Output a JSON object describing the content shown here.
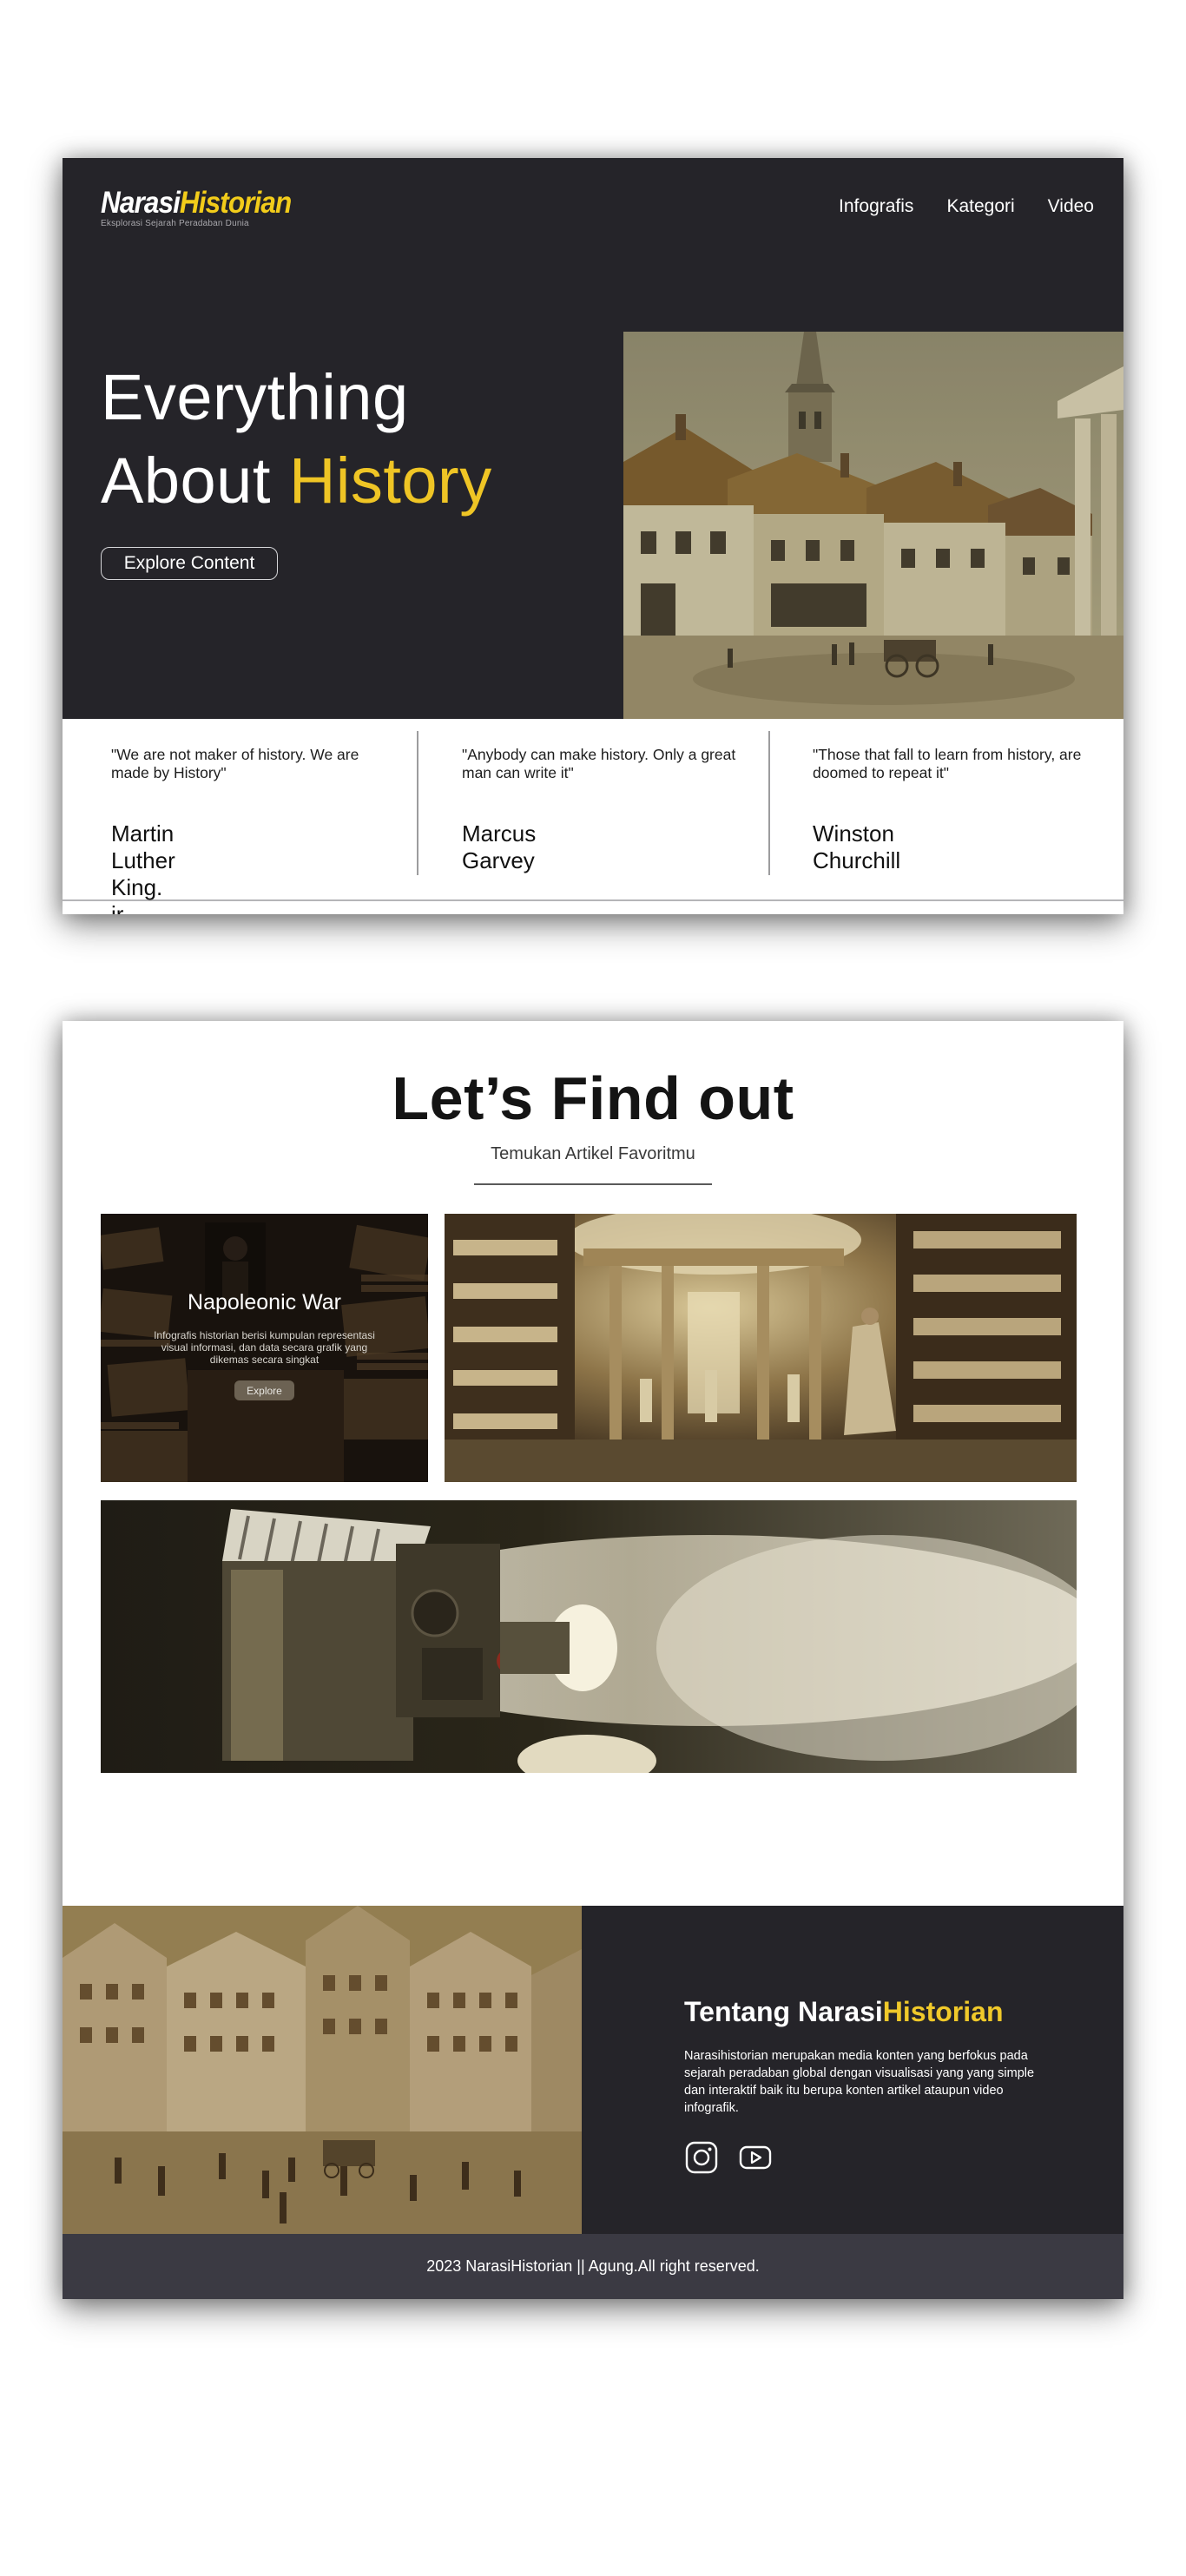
{
  "header": {
    "logo_part1": "Narasi",
    "logo_part2": "Historian",
    "tagline": "Eksplorasi Sejarah Peradaban Dunia",
    "nav": [
      "Infografis",
      "Kategori",
      "Video"
    ]
  },
  "hero": {
    "title_line1": "Everything",
    "title_line2_prefix": "About ",
    "title_line2_highlight": "History",
    "button_label": "Explore Content"
  },
  "quotes": [
    {
      "text": "\"We are not maker of history. We are made by History\"",
      "author": "Martin Luther King. jr"
    },
    {
      "text": "\"Anybody can make history. Only a great man can write it\"",
      "author": "Marcus Garvey"
    },
    {
      "text": "\"Those that fall to learn from history, are doomed to repeat it\"",
      "author": "Winston Churchill"
    }
  ],
  "find": {
    "title": "Let’s Find out",
    "subtitle": "Temukan Artikel Favoritmu"
  },
  "tiles": {
    "napoleon": {
      "title": "Napoleonic War",
      "description": "Infografis historian berisi kumpulan representasi visual informasi, dan data secara grafik yang dikemas secara singkat",
      "button_label": "Explore"
    }
  },
  "about": {
    "title_prefix": "Tentang Narasi",
    "title_highlight": "Historian",
    "description": "Narasihistorian merupakan media konten yang berfokus pada sejarah peradaban global dengan visualisasi yang yang simple dan interaktif baik itu berupa konten artikel ataupun video infografik."
  },
  "social": [
    "instagram-icon",
    "youtube-icon"
  ],
  "footer": {
    "copyright": "2023 NarasiHistorian || Agung.All right reserved."
  },
  "colors": {
    "dark_bg": "#252429",
    "accent_yellow": "#efc525",
    "footer_bar": "#3b3a43"
  }
}
